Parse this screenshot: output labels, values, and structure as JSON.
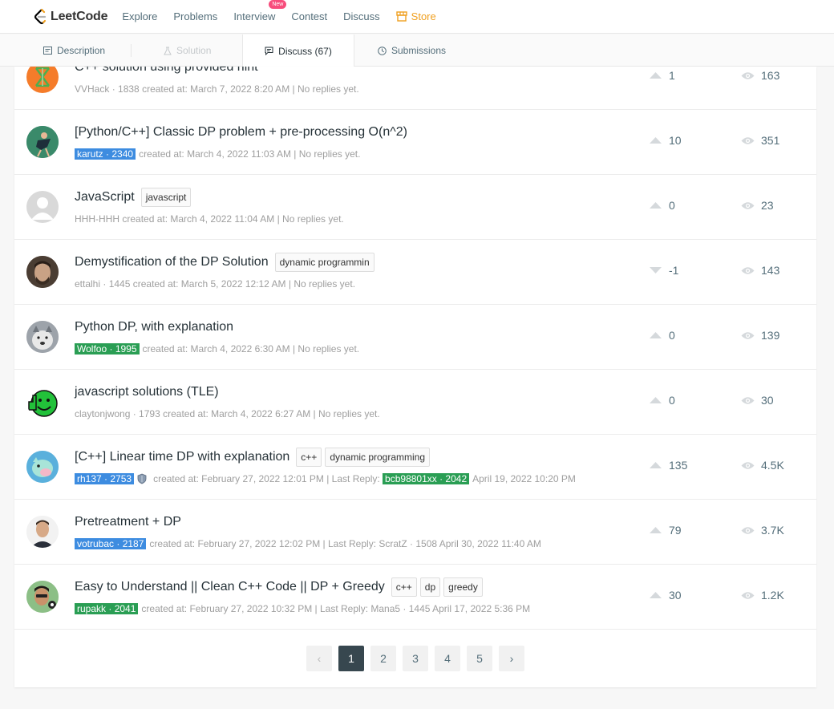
{
  "nav": {
    "logo_text": "LeetCode",
    "items": [
      "Explore",
      "Problems",
      "Interview",
      "Contest",
      "Discuss"
    ],
    "new_badge": "New",
    "store": "Store"
  },
  "tabs": {
    "description": "Description",
    "solution": "Solution",
    "discuss": "Discuss (67)",
    "submissions": "Submissions"
  },
  "posts": [
    {
      "title": "C++ solution using provided hint",
      "tags": [],
      "user": "VVHack",
      "rep": "1838",
      "badge": "",
      "created": "created at: March 7, 2022 8:20 AM",
      "reply_info": "No replies yet.",
      "vote": "1",
      "views": "163"
    },
    {
      "title": "[Python/C++] Classic DP problem + pre-processing O(n^2)",
      "tags": [],
      "user": "karutz",
      "rep": "2340",
      "badge": "blue",
      "created": "created at: March 4, 2022 11:03 AM",
      "reply_info": "No replies yet.",
      "vote": "10",
      "views": "351"
    },
    {
      "title": "JavaScript",
      "tags": [
        "javascript"
      ],
      "user": "HHH-HHH",
      "rep": "",
      "badge": "",
      "created": "created at: March 4, 2022 11:04 AM",
      "reply_info": "No replies yet.",
      "vote": "0",
      "views": "23"
    },
    {
      "title": "Demystification of the DP Solution",
      "tags": [
        "dynamic programmin"
      ],
      "user": "ettalhi",
      "rep": "1445",
      "badge": "",
      "created": "created at: March 5, 2022 12:12 AM",
      "reply_info": "No replies yet.",
      "vote": "-1",
      "views": "143"
    },
    {
      "title": "Python DP, with explanation",
      "tags": [],
      "user": "Wolfoo",
      "rep": "1995",
      "badge": "green",
      "created": "created at: March 4, 2022 6:30 AM",
      "reply_info": "No replies yet.",
      "vote": "0",
      "views": "139"
    },
    {
      "title": "javascript solutions (TLE)",
      "tags": [],
      "user": "claytonjwong",
      "rep": "1793",
      "badge": "",
      "created": "created at: March 4, 2022 6:27 AM",
      "reply_info": "No replies yet.",
      "vote": "0",
      "views": "30"
    },
    {
      "title": "[C++] Linear time DP with explanation",
      "tags": [
        "c++",
        "dynamic programming"
      ],
      "user": "rh137",
      "rep": "2753",
      "badge": "blue",
      "created": "created at: February 27, 2022 12:01 PM",
      "reply_info": "Last Reply:",
      "reply_user": "bcb98801xx · 2042",
      "reply_badge": "green",
      "reply_date": "April 19, 2022 10:20 PM",
      "vote": "135",
      "views": "4.5K"
    },
    {
      "title": "Pretreatment + DP",
      "tags": [],
      "user": "votrubac",
      "rep": "2187",
      "badge": "blue",
      "created": "created at: February 27, 2022 12:02 PM",
      "reply_info": "Last Reply: ScratZ · 1508 April 30, 2022 11:40 AM",
      "vote": "79",
      "views": "3.7K"
    },
    {
      "title": "Easy to Understand || Clean C++ Code || DP + Greedy",
      "tags": [
        "c++",
        "dp",
        "greedy"
      ],
      "user": "rupakk",
      "rep": "2041",
      "badge": "green",
      "created": "created at: February 27, 2022 10:32 PM",
      "reply_info": "Last Reply: Mana5 · 1445 April 17, 2022 5:36 PM",
      "vote": "30",
      "views": "1.2K"
    }
  ],
  "pagination": {
    "prev": "‹",
    "pages": [
      "1",
      "2",
      "3",
      "4",
      "5"
    ],
    "next": "›",
    "current": "1"
  },
  "colors": {
    "blue_badge": "#3d8ce0",
    "green_badge": "#2a9e54",
    "store": "#f0a020",
    "active_page": "#37474f"
  },
  "icons": [
    "leetcode-logo-icon",
    "store-icon",
    "description-icon",
    "solution-icon",
    "discuss-icon",
    "submissions-icon",
    "upvote-icon",
    "downvote-icon",
    "views-icon",
    "shield-icon"
  ]
}
